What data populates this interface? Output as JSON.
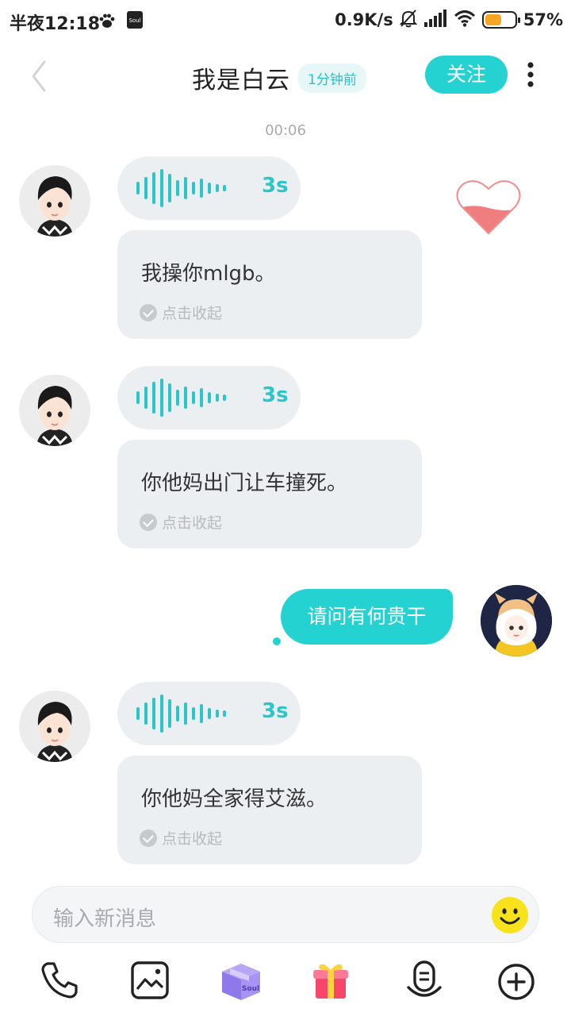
{
  "status_bar": {
    "time": "半夜12:18",
    "network_speed": "0.9K/s",
    "battery_percent": "57%"
  },
  "header": {
    "title": "我是白云",
    "time_badge": "1分钟前",
    "follow_label": "关注"
  },
  "chat": {
    "timestamp": "00:06",
    "messages": [
      {
        "voice_duration": "3s",
        "text": "我操你mlgb。",
        "collapse_label": "点击收起"
      },
      {
        "voice_duration": "3s",
        "text": "你他妈出门让车撞死。",
        "collapse_label": "点击收起"
      },
      {
        "my_text": "请问有何贵干"
      },
      {
        "voice_duration": "3s",
        "text": "你他妈全家得艾滋。",
        "collapse_label": "点击收起"
      }
    ]
  },
  "input": {
    "placeholder": "输入新消息"
  },
  "toolbar": {
    "gift_box_text": "Soul"
  },
  "colors": {
    "accent": "#25d2d2",
    "bubble_bg": "#eceff1"
  }
}
